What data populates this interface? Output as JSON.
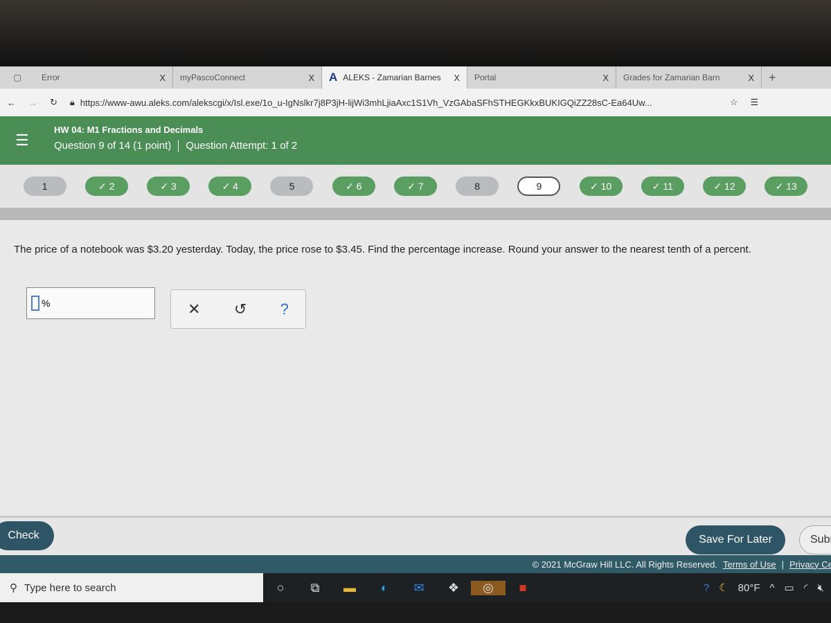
{
  "browser": {
    "tabs": [
      {
        "label": "Error",
        "active": false
      },
      {
        "label": "myPascoConnect",
        "active": false
      },
      {
        "label": "ALEKS - Zamarian Barnes",
        "active": true
      },
      {
        "label": "Portal",
        "active": false
      },
      {
        "label": "Grades for Zamarian Barn",
        "active": false
      }
    ],
    "new_tab": "+",
    "close": "X",
    "url": "https://www-awu.aleks.com/alekscgi/x/Isl.exe/1o_u-IgNslkr7j8P3jH-lijWi3mhLjiaAxc1S1Vh_VzGAbaSFhSTHEGKkxBUKIGQiZZ28sC-Ea64Uw..."
  },
  "header": {
    "title": "HW 04: M1 Fractions and Decimals",
    "question_info": "Question 9 of 14 (1 point)",
    "attempt": "Question Attempt: 1 of 2",
    "accent": "#4a8d55"
  },
  "questions": [
    {
      "label": "1",
      "state": "todo"
    },
    {
      "label": "✓ 2",
      "state": "done"
    },
    {
      "label": "✓ 3",
      "state": "done"
    },
    {
      "label": "✓ 4",
      "state": "done"
    },
    {
      "label": "5",
      "state": "todo"
    },
    {
      "label": "✓ 6",
      "state": "done"
    },
    {
      "label": "✓ 7",
      "state": "done"
    },
    {
      "label": "8",
      "state": "todo"
    },
    {
      "label": "9",
      "state": "cur"
    },
    {
      "label": "✓ 10",
      "state": "done"
    },
    {
      "label": "✓ 11",
      "state": "done"
    },
    {
      "label": "✓ 12",
      "state": "done"
    },
    {
      "label": "✓ 13",
      "state": "done"
    }
  ],
  "question": {
    "text": "The price of a notebook was $3.20 yesterday. Today, the price rose to $3.45. Find the percentage increase. Round your answer to the nearest tenth of a percent.",
    "answer_value": "",
    "unit": "%"
  },
  "tools": {
    "clear": "✕",
    "undo": "↺",
    "help": "?"
  },
  "buttons": {
    "check": "Check",
    "save": "Save For Later",
    "submit": "Submit"
  },
  "footer": {
    "copyright": "© 2021 McGraw Hill LLC. All Rights Reserved.",
    "terms": "Terms of Use",
    "privacy": "Privacy Center"
  },
  "taskbar": {
    "search_placeholder": "Type here to search",
    "temperature": "80°F"
  }
}
